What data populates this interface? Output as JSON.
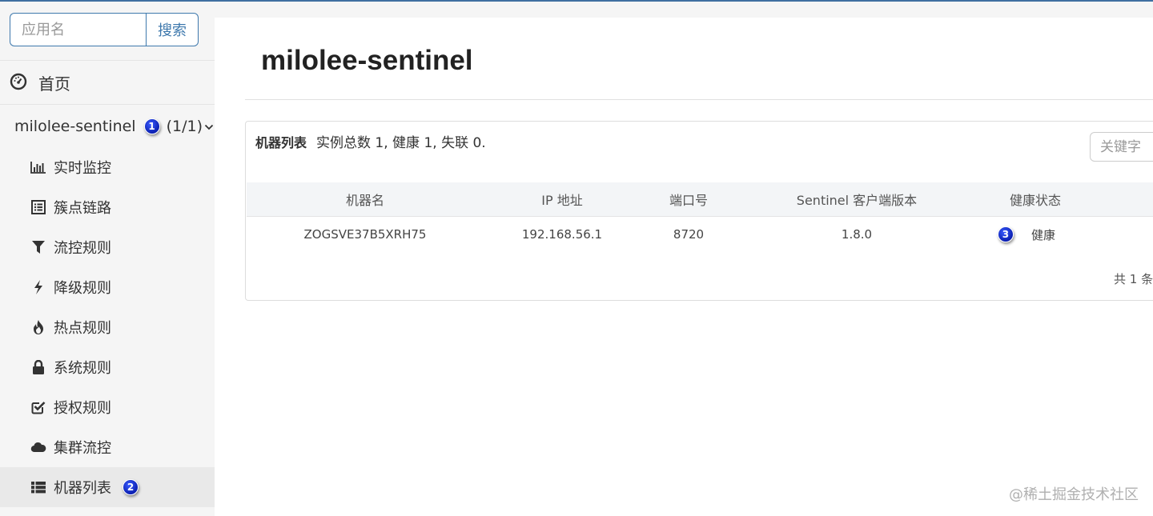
{
  "search": {
    "placeholder": "应用名",
    "button": "搜索"
  },
  "home": {
    "label": "首页",
    "icon": "dashboard-icon"
  },
  "app": {
    "name": "milolee-sentinel",
    "count": "(1/1)",
    "badge": "1"
  },
  "menu": [
    {
      "label": "实时监控",
      "icon": "bar-chart-icon"
    },
    {
      "label": "簇点链路",
      "icon": "list-icon"
    },
    {
      "label": "流控规则",
      "icon": "filter-icon"
    },
    {
      "label": "降级规则",
      "icon": "bolt-icon"
    },
    {
      "label": "热点规则",
      "icon": "fire-icon"
    },
    {
      "label": "系统规则",
      "icon": "lock-icon"
    },
    {
      "label": "授权规则",
      "icon": "check-square-icon"
    },
    {
      "label": "集群流控",
      "icon": "cloud-icon"
    },
    {
      "label": "机器列表",
      "icon": "th-list-icon",
      "badge": "2"
    }
  ],
  "main": {
    "title": "milolee-sentinel",
    "panel": {
      "title": "机器列表",
      "summary": "实例总数 1, 健康 1, 失联 0.",
      "keyword_placeholder": "关键字",
      "columns": [
        "机器名",
        "IP 地址",
        "端口号",
        "Sentinel 客户端版本",
        "健康状态"
      ],
      "rows": [
        {
          "hostname": "ZOGSVE37B5XRH75",
          "ip": "192.168.56.1",
          "port": "8720",
          "version": "1.8.0",
          "status": "健康",
          "badge": "3"
        }
      ],
      "pager": "共 1 条"
    }
  },
  "watermark": "@稀土掘金技术社区",
  "colors": {
    "accent": "#3f79ad",
    "badge": "#0b1fb0"
  }
}
